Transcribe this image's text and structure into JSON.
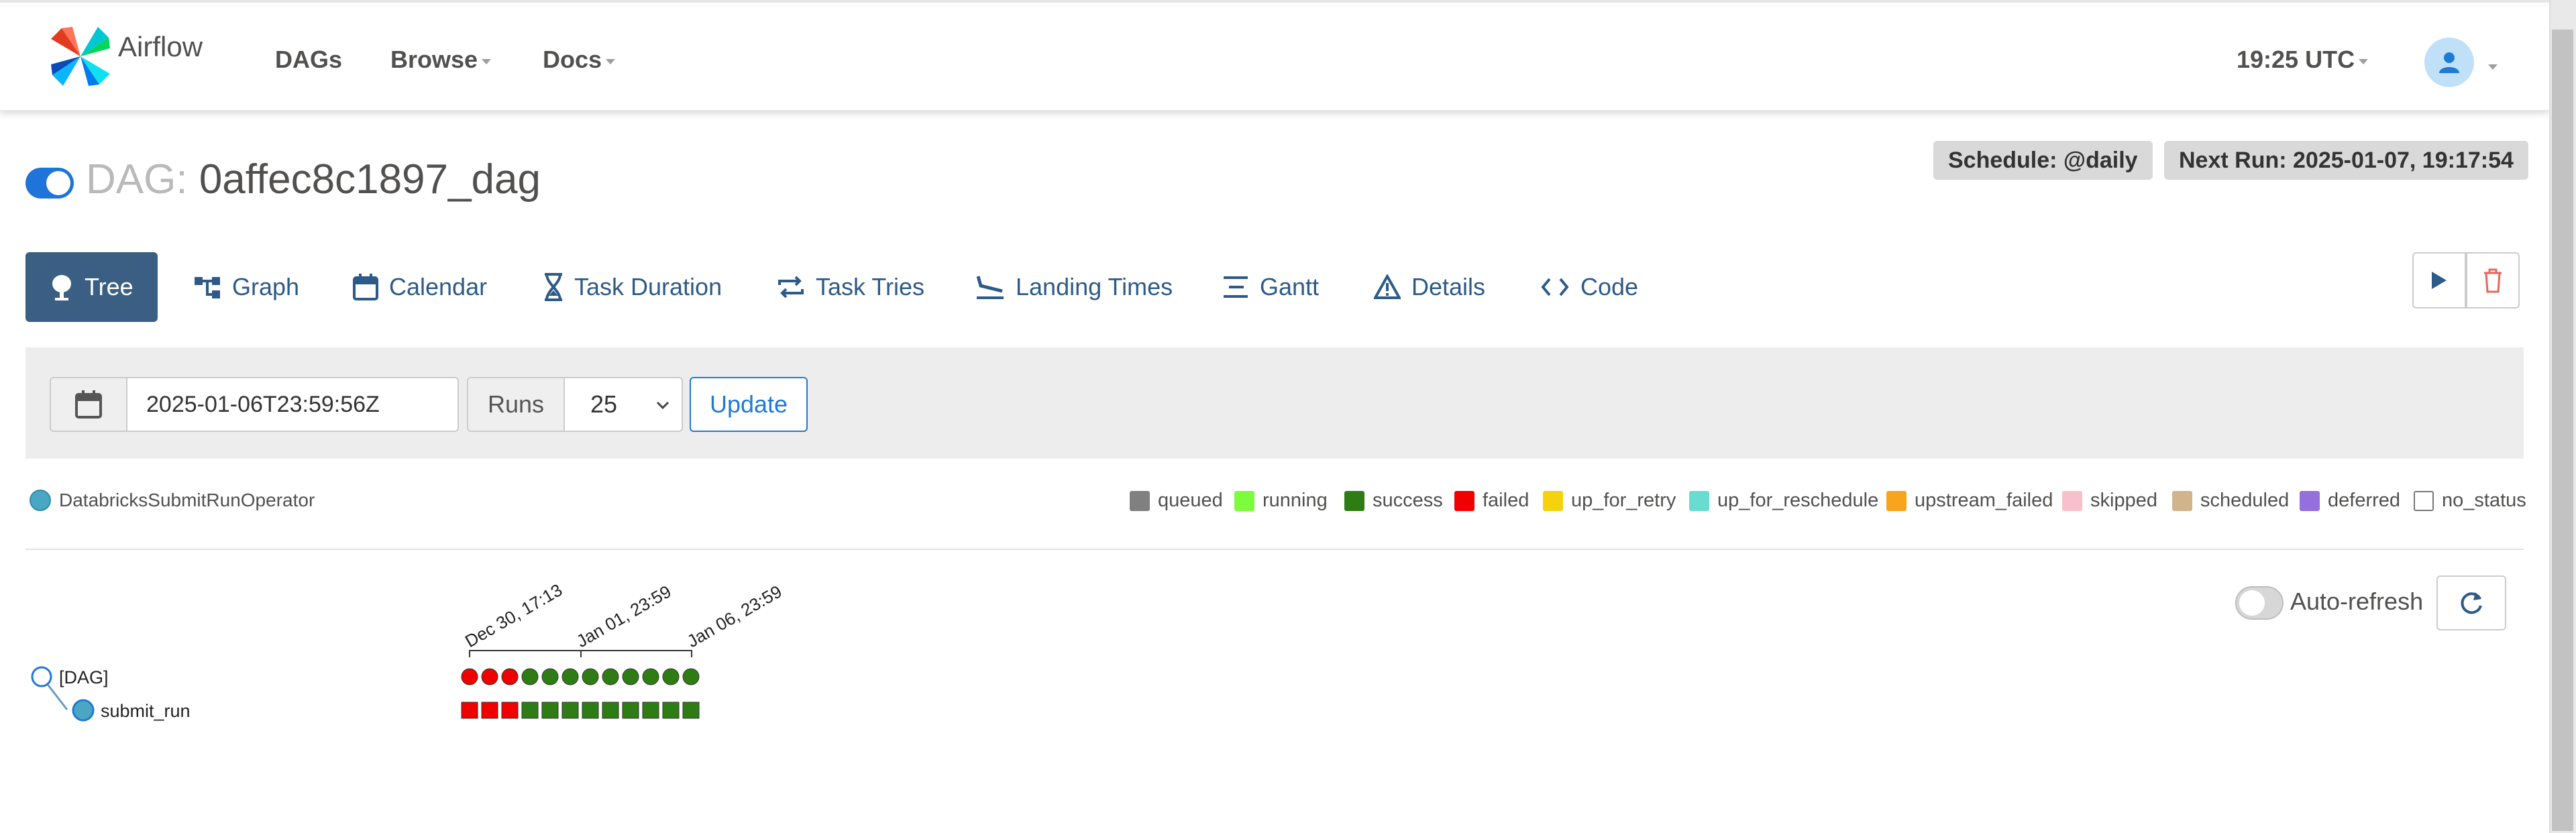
{
  "navbar": {
    "brand": "Airflow",
    "items": [
      "DAGs",
      "Browse",
      "Docs"
    ],
    "clock": "19:25 UTC"
  },
  "dag": {
    "prefix": "DAG:",
    "name": "0affec8c1897_dag",
    "paused": false,
    "schedule": "Schedule: @daily",
    "next_run": "Next Run: 2025-01-07, 19:17:54"
  },
  "tabs": [
    "Tree",
    "Graph",
    "Calendar",
    "Task Duration",
    "Task Tries",
    "Landing Times",
    "Gantt",
    "Details",
    "Code"
  ],
  "filters": {
    "base_date": "2025-01-06T23:59:56Z",
    "runs_label": "Runs",
    "runs_value": "25",
    "update_label": "Update"
  },
  "operator_legend": {
    "label": "DatabricksSubmitRunOperator",
    "color": "#4aa7c3"
  },
  "state_legend": [
    {
      "label": "queued",
      "color": "#808080"
    },
    {
      "label": "running",
      "color": "#7cfc3c"
    },
    {
      "label": "success",
      "color": "#2e7d14"
    },
    {
      "label": "failed",
      "color": "#f00000"
    },
    {
      "label": "up_for_retry",
      "color": "#f5d20f"
    },
    {
      "label": "up_for_reschedule",
      "color": "#69dcd2"
    },
    {
      "label": "upstream_failed",
      "color": "#f7a51c"
    },
    {
      "label": "skipped",
      "color": "#f8c0cb"
    },
    {
      "label": "scheduled",
      "color": "#d2b48c"
    },
    {
      "label": "deferred",
      "color": "#9370db"
    },
    {
      "label": "no_status",
      "color": "#ffffff"
    }
  ],
  "auto_refresh": {
    "label": "Auto-refresh",
    "enabled": false
  },
  "tree": {
    "date_labels": [
      "Dec 30, 17:13",
      "Jan 01, 23:59",
      "Jan 06, 23:59"
    ],
    "nodes": [
      "[DAG]",
      "submit_run"
    ],
    "runs": [
      "failed",
      "failed",
      "failed",
      "success",
      "success",
      "success",
      "success",
      "success",
      "success",
      "success",
      "success",
      "success"
    ],
    "tasks": [
      "failed",
      "failed",
      "failed",
      "success",
      "success",
      "success",
      "success",
      "success",
      "success",
      "success",
      "success",
      "success"
    ]
  }
}
